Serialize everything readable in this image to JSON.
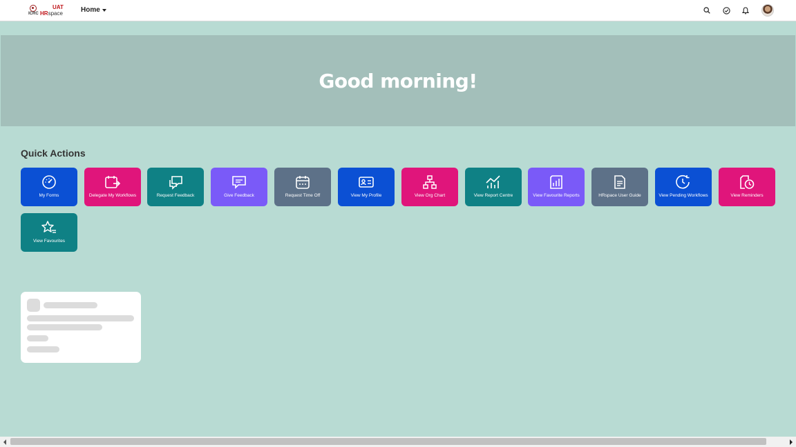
{
  "header": {
    "logo": {
      "org": "ICRC",
      "env": "UAT",
      "brand_prefix": "HR",
      "brand_suffix": "space"
    },
    "menu": {
      "label": "Home"
    },
    "icons": [
      "search-icon",
      "todo-check-icon",
      "bell-icon",
      "avatar"
    ]
  },
  "hero": {
    "greeting": "Good morning!"
  },
  "quick_actions": {
    "title": "Quick Actions",
    "tiles": [
      {
        "label": "My Forms",
        "color": "#0b50d4",
        "icon": "gauge-icon"
      },
      {
        "label": "Delegate My Workflows",
        "color": "#e0157b",
        "icon": "calendar-forward-icon"
      },
      {
        "label": "Request Feedback",
        "color": "#0f8185",
        "icon": "chat-bubbles-icon"
      },
      {
        "label": "Give Feedback",
        "color": "#7a5af8",
        "icon": "chat-lines-icon"
      },
      {
        "label": "Request Time Off",
        "color": "#5d7188",
        "icon": "calendar-icon"
      },
      {
        "label": "View My Profile",
        "color": "#0b50d4",
        "icon": "profile-card-icon"
      },
      {
        "label": "View Org Chart",
        "color": "#e0157b",
        "icon": "org-chart-icon"
      },
      {
        "label": "View Report Centre",
        "color": "#0f8185",
        "icon": "line-chart-icon"
      },
      {
        "label": "View Favourite Reports",
        "color": "#7a5af8",
        "icon": "reports-star-icon"
      },
      {
        "label": "HRspace User Guide",
        "color": "#5d7188",
        "icon": "document-icon"
      },
      {
        "label": "View Pending Workflows",
        "color": "#0b50d4",
        "icon": "refresh-clock-icon"
      },
      {
        "label": "View Reminders",
        "color": "#e0157b",
        "icon": "reminder-icon"
      },
      {
        "label": "View Favourites",
        "color": "#0f8185",
        "icon": "star-list-icon"
      }
    ]
  }
}
